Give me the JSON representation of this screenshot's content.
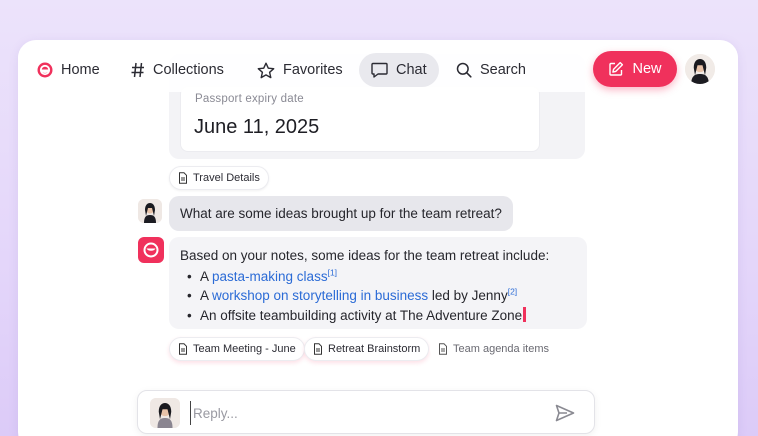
{
  "nav": {
    "items": [
      {
        "label": "Home",
        "icon": "home-logo-icon"
      },
      {
        "label": "Collections",
        "icon": "hash-icon"
      },
      {
        "label": "Favorites",
        "icon": "star-icon"
      },
      {
        "label": "Chat",
        "icon": "chat-bubble-icon",
        "active": true
      },
      {
        "label": "Search",
        "icon": "search-icon"
      }
    ],
    "new_label": "New",
    "new_icon": "edit-icon"
  },
  "conversation": {
    "passport": {
      "label": "Passport expiry date",
      "value": "June 11, 2025"
    },
    "passport_source": "Travel Details",
    "user_message": "What are some ideas brought up for the team retreat?",
    "assistant": {
      "intro": "Based on your notes, some ideas for the team retreat include:",
      "bullets": [
        {
          "pre": "A ",
          "link": "pasta-making class",
          "cite": "[1]",
          "post": ""
        },
        {
          "pre": "A ",
          "link": "workshop on storytelling in business",
          "cite": "",
          "post": " led by Jenny",
          "cite2": "[2]"
        },
        {
          "pre": "An offsite teambuilding activity at The Adventure Zone",
          "link": "",
          "cite": "",
          "post": ""
        }
      ],
      "sources": [
        "Team Meeting - June",
        "Retreat Brainstorm",
        "Team agenda items"
      ]
    }
  },
  "reply": {
    "placeholder": "Reply..."
  },
  "colors": {
    "accent": "#f0315c",
    "link": "#2b6bd6",
    "active_tab_bg": "#e9e9ee"
  }
}
